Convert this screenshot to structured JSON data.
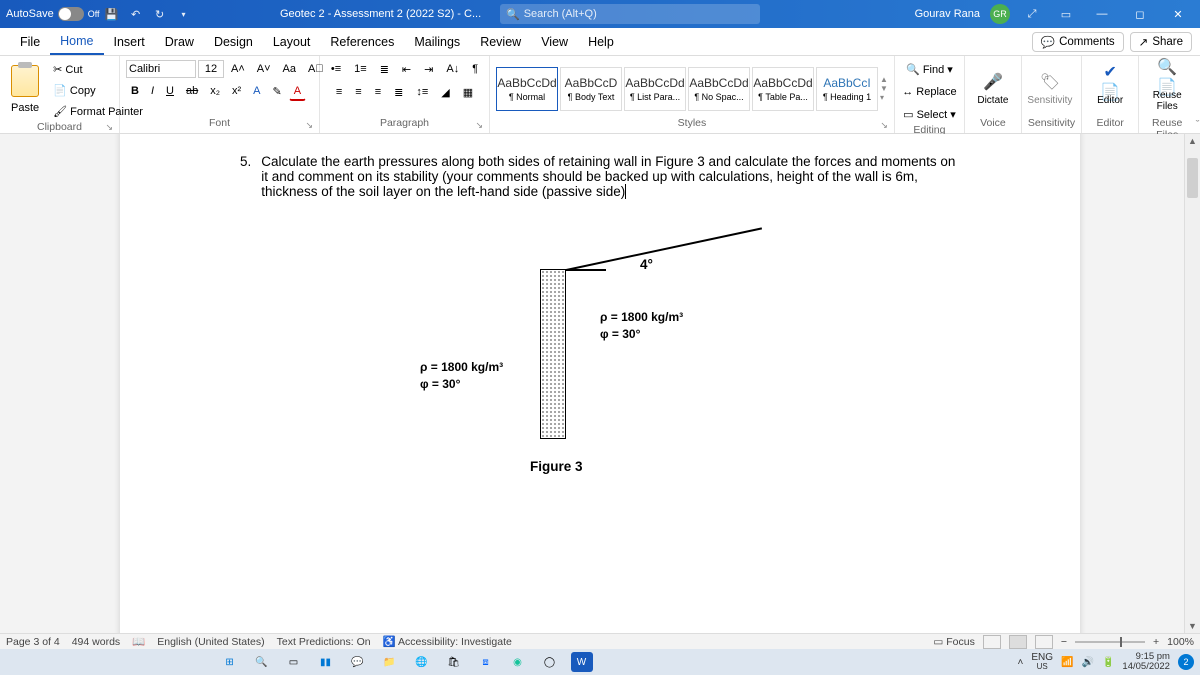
{
  "title_bar": {
    "autosave_label": "AutoSave",
    "autosave_state": "Off",
    "doc_title": "Geotec 2 - Assessment 2 (2022 S2)  -  C...",
    "search_placeholder": "Search (Alt+Q)",
    "user_name": "Gourav Rana",
    "user_initials": "GR"
  },
  "tabs": {
    "items": [
      "File",
      "Home",
      "Insert",
      "Draw",
      "Design",
      "Layout",
      "References",
      "Mailings",
      "Review",
      "View",
      "Help"
    ],
    "comments": "Comments",
    "share": "Share"
  },
  "ribbon": {
    "clipboard": {
      "cut": "Cut",
      "copy": "Copy",
      "format_painter": "Format Painter",
      "paste": "Paste",
      "label": "Clipboard"
    },
    "font": {
      "name": "Calibri",
      "size": "12",
      "grow": "A˄",
      "shrink": "A˅",
      "case": "Aa",
      "clear": "A⃠",
      "b": "B",
      "i": "I",
      "u": "U",
      "strike": "ab",
      "sub": "x₂",
      "sup": "x²",
      "effects": "A",
      "highlight": "✎",
      "color": "A",
      "label": "Font"
    },
    "paragraph": {
      "label": "Paragraph",
      "pilcrow": "¶",
      "sort": "A↓"
    },
    "styles": {
      "label": "Styles",
      "items": [
        {
          "prev": "AaBbCcDd",
          "name": "¶ Normal"
        },
        {
          "prev": "AaBbCcD",
          "name": "¶ Body Text"
        },
        {
          "prev": "AaBbCcDd",
          "name": "¶ List Para..."
        },
        {
          "prev": "AaBbCcDd",
          "name": "¶ No Spac..."
        },
        {
          "prev": "AaBbCcDd",
          "name": "¶ Table Pa..."
        },
        {
          "prev": "AaBbCcI",
          "name": "¶ Heading 1"
        }
      ]
    },
    "editing": {
      "find": "Find",
      "replace": "Replace",
      "select": "Select",
      "label": "Editing"
    },
    "voice": {
      "dictate": "Dictate",
      "label": "Voice"
    },
    "sensitivity": {
      "btn": "Sensitivity",
      "label": "Sensitivity"
    },
    "editor": {
      "btn": "Editor",
      "label": "Editor"
    },
    "reuse": {
      "btn": "Reuse Files",
      "label": "Reuse Files"
    }
  },
  "document": {
    "q_num": "5.",
    "q_text": "Calculate the earth pressures along both sides of retaining wall in Figure 3 and calculate the forces and moments on it and comment on its stability (your comments should be backed up with calculations, height of the wall is 6m, thickness of the soil layer on the left-hand side (passive side)",
    "angle": "4°",
    "soil_right_line1": "ρ = 1800 kg/m³",
    "soil_right_line2": "φ = 30°",
    "soil_left_line1": "ρ = 1800 kg/m³",
    "soil_left_line2": "φ = 30°",
    "fig_caption": "Figure 3"
  },
  "status": {
    "page": "Page 3 of 4",
    "words": "494 words",
    "lang": "English (United States)",
    "predictions": "Text Predictions: On",
    "accessibility": "Accessibility: Investigate",
    "focus": "Focus",
    "zoom": "100%"
  },
  "taskbar": {
    "lang": "ENG",
    "lang_sub": "US",
    "time": "9:15 pm",
    "date": "14/05/2022",
    "notif": "2"
  }
}
